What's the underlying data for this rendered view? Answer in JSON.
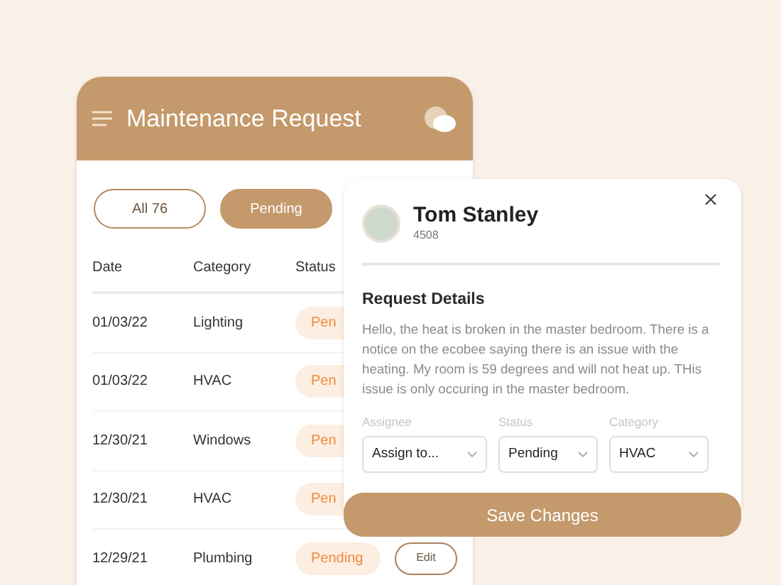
{
  "app": {
    "title": "Maintenance Request",
    "filters": [
      {
        "label": "All 76",
        "selected": false
      },
      {
        "label": "Pending",
        "selected": true
      }
    ],
    "table": {
      "columns": [
        "Date",
        "Category",
        "Status"
      ],
      "rows": [
        {
          "date": "01/03/22",
          "category": "Lighting",
          "status": "Pen",
          "action": null
        },
        {
          "date": "01/03/22",
          "category": "HVAC",
          "status": "Pen",
          "action": null
        },
        {
          "date": "12/30/21",
          "category": "Windows",
          "status": "Pen",
          "action": null
        },
        {
          "date": "12/30/21",
          "category": "HVAC",
          "status": "Pen",
          "action": null
        },
        {
          "date": "12/29/21",
          "category": "Plumbing",
          "status": "Pending",
          "action": "Edit"
        }
      ]
    }
  },
  "detail": {
    "name": "Tom Stanley",
    "id": "4508",
    "section_title": "Request Details",
    "description": "Hello, the heat is broken in the master bedroom. There is a notice on the ecobee saying there is an issue with the heating. My room is 59 degrees and will not heat up. THis issue is only occuring in the master bedroom.",
    "fields": [
      {
        "label": "Assignee",
        "value": "Assign to..."
      },
      {
        "label": "Status",
        "value": "Pending"
      },
      {
        "label": "Category",
        "value": "HVAC"
      }
    ],
    "save_button": "Save Changes"
  }
}
